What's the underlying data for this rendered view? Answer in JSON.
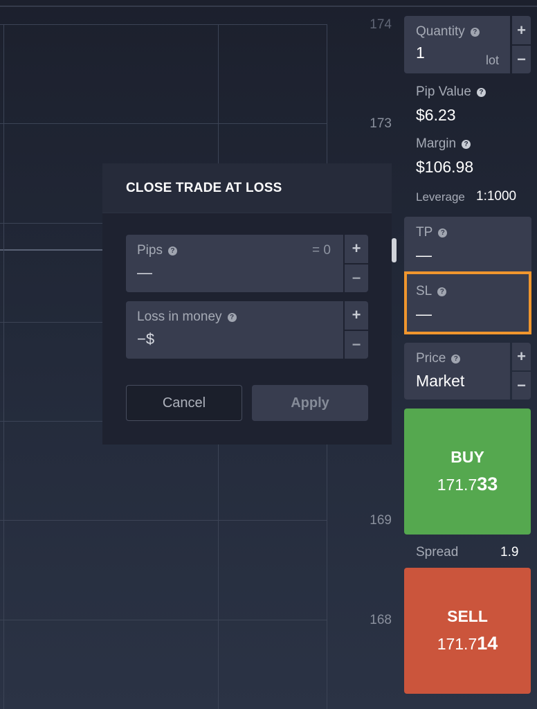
{
  "chart": {
    "y_axis_labels": [
      "174",
      "173",
      "169",
      "168"
    ]
  },
  "dialog": {
    "title": "CLOSE TRADE AT LOSS",
    "pips": {
      "label": "Pips",
      "equivalent": "= 0",
      "value": "—",
      "plus": "+",
      "minus": "−"
    },
    "loss_money": {
      "label": "Loss in money",
      "value": "−$",
      "plus": "+",
      "minus": "−"
    },
    "cancel_label": "Cancel",
    "apply_label": "Apply",
    "help_glyph": "?"
  },
  "panel": {
    "quantity": {
      "label": "Quantity",
      "value": "1",
      "unit": "lot",
      "plus": "+",
      "minus": "−"
    },
    "pip_value": {
      "label": "Pip Value",
      "value": "$6.23"
    },
    "margin": {
      "label": "Margin",
      "value": "$106.98"
    },
    "leverage": {
      "label": "Leverage",
      "value": "1:1000"
    },
    "tp": {
      "label": "TP",
      "value": "—"
    },
    "sl": {
      "label": "SL",
      "value": "—",
      "highlight_color": "#f0962e"
    },
    "price": {
      "label": "Price",
      "value": "Market",
      "plus": "+",
      "minus": "−"
    },
    "buy": {
      "label": "BUY",
      "price_main": "171.7",
      "price_emph": "33",
      "color": "#55a84f"
    },
    "spread": {
      "label": "Spread",
      "value": "1.9"
    },
    "sell": {
      "label": "SELL",
      "price_main": "171.7",
      "price_emph": "14",
      "color": "#cb553c"
    }
  }
}
